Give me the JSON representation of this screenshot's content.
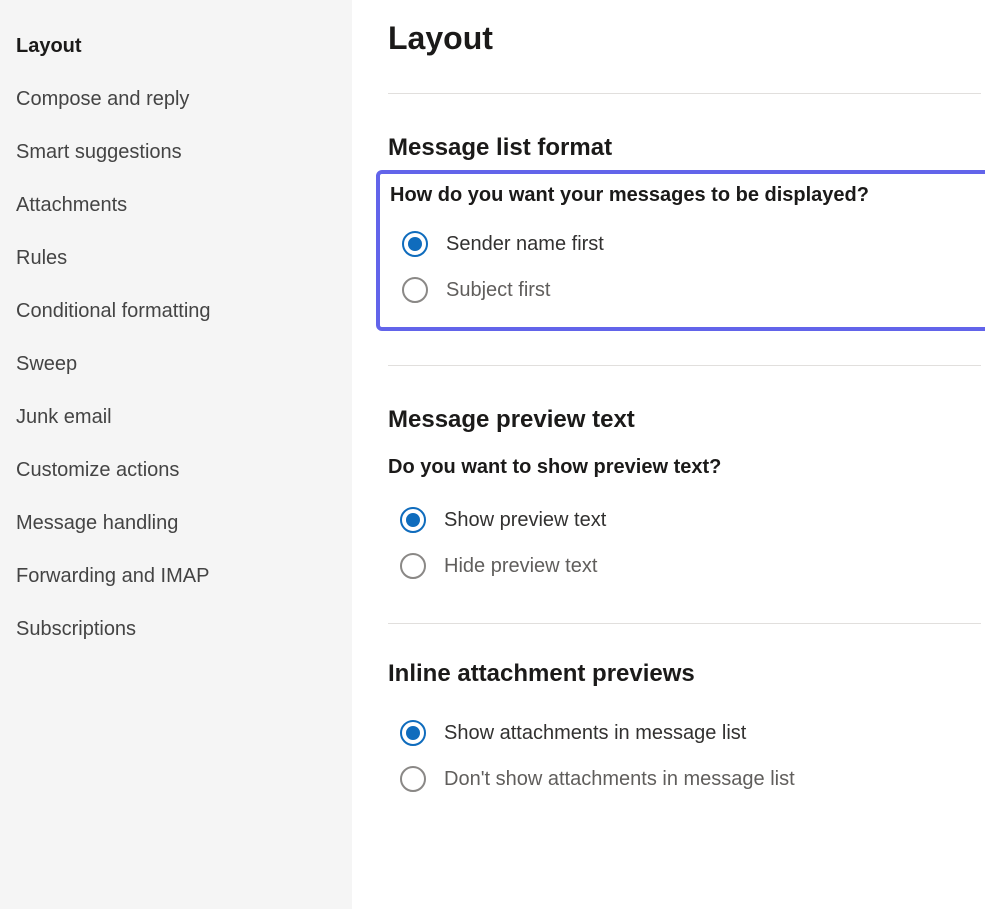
{
  "sidebar": {
    "items": [
      {
        "label": "Layout",
        "active": true
      },
      {
        "label": "Compose and reply",
        "active": false
      },
      {
        "label": "Smart suggestions",
        "active": false
      },
      {
        "label": "Attachments",
        "active": false
      },
      {
        "label": "Rules",
        "active": false
      },
      {
        "label": "Conditional formatting",
        "active": false
      },
      {
        "label": "Sweep",
        "active": false
      },
      {
        "label": "Junk email",
        "active": false
      },
      {
        "label": "Customize actions",
        "active": false
      },
      {
        "label": "Message handling",
        "active": false
      },
      {
        "label": "Forwarding and IMAP",
        "active": false
      },
      {
        "label": "Subscriptions",
        "active": false
      }
    ]
  },
  "main": {
    "title": "Layout",
    "sections": {
      "messageListFormat": {
        "title": "Message list format",
        "question": "How do you want your messages to be displayed?",
        "options": [
          {
            "label": "Sender name first",
            "checked": true
          },
          {
            "label": "Subject first",
            "checked": false
          }
        ]
      },
      "messagePreviewText": {
        "title": "Message preview text",
        "question": "Do you want to show preview text?",
        "options": [
          {
            "label": "Show preview text",
            "checked": true
          },
          {
            "label": "Hide preview text",
            "checked": false
          }
        ]
      },
      "inlineAttachmentPreviews": {
        "title": "Inline attachment previews",
        "options": [
          {
            "label": "Show attachments in message list",
            "checked": true
          },
          {
            "label": "Don't show attachments in message list",
            "checked": false
          }
        ]
      }
    }
  }
}
